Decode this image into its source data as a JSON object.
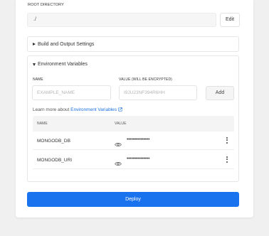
{
  "root_directory": {
    "label": "ROOT DIRECTORY",
    "value": "./",
    "edit_label": "Edit"
  },
  "build_settings": {
    "label": "Build and Output Settings",
    "expanded": false
  },
  "env": {
    "title": "Environment Variables",
    "expanded": true,
    "name_label": "NAME",
    "value_label": "VALUE (WILL BE ENCRYPTED)",
    "name_placeholder": "EXAMPLE_NAME",
    "value_placeholder": "I9JU23NF394R6HH",
    "add_label": "Add",
    "learn_prefix": "Learn more about",
    "learn_link": "Environment Variables",
    "table": {
      "col_name": "NAME",
      "col_value": "VALUE",
      "rows": [
        {
          "name": "MONGODB_DB",
          "value": "•••••••••••••••"
        },
        {
          "name": "MONGODB_URI",
          "value": "•••••••••••••••"
        }
      ]
    }
  },
  "deploy_label": "Deploy",
  "colors": {
    "accent": "#1a73ee",
    "link": "#1a6fe0"
  }
}
